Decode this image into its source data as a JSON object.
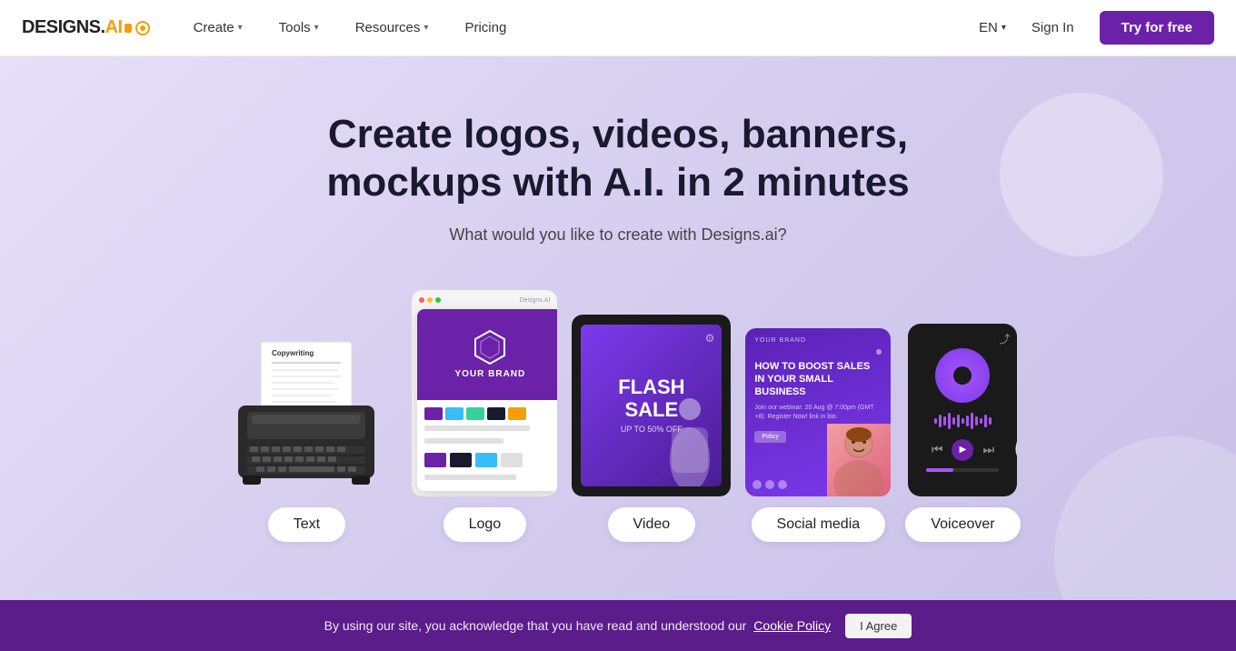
{
  "navbar": {
    "logo": "DESIGNS.AI",
    "logo_designs": "DESIGNS.",
    "logo_ai": "AI",
    "nav_items": [
      {
        "label": "Create",
        "has_dropdown": true
      },
      {
        "label": "Tools",
        "has_dropdown": true
      },
      {
        "label": "Resources",
        "has_dropdown": true
      }
    ],
    "pricing_label": "Pricing",
    "lang": "EN",
    "sign_in": "Sign In",
    "try_free": "Try for free"
  },
  "hero": {
    "title": "Create logos, videos, banners, mockups with A.I. in 2 minutes",
    "subtitle": "What would you like to create with Designs.ai?"
  },
  "cards": [
    {
      "id": "text",
      "label": "Text"
    },
    {
      "id": "logo",
      "label": "Logo"
    },
    {
      "id": "video",
      "label": "Video"
    },
    {
      "id": "social",
      "label": "Social media"
    },
    {
      "id": "voice",
      "label": "Voiceover"
    }
  ],
  "logo_card": {
    "brand": "YOUR BRAND",
    "swatches": [
      "#6b21a8",
      "#38bdf8",
      "#34d399",
      "#1a1a2e",
      "#f59e0b"
    ]
  },
  "video_card": {
    "flash_line1": "FLASH",
    "flash_line2": "SALE",
    "flash_sub": "UP TO 50% OFF"
  },
  "social_card": {
    "brand": "YOUR BRAND",
    "title": "HOW TO BOOST SALES IN YOUR SMALL BUSINESS",
    "desc": "Join our webinar: 20 Aug @ 7:00pm (GMT +8). Register Now! link in bio."
  },
  "cookie": {
    "text": "By using our site, you acknowledge that you have read and understood our",
    "link": "Cookie Policy",
    "agree": "I Agree"
  }
}
